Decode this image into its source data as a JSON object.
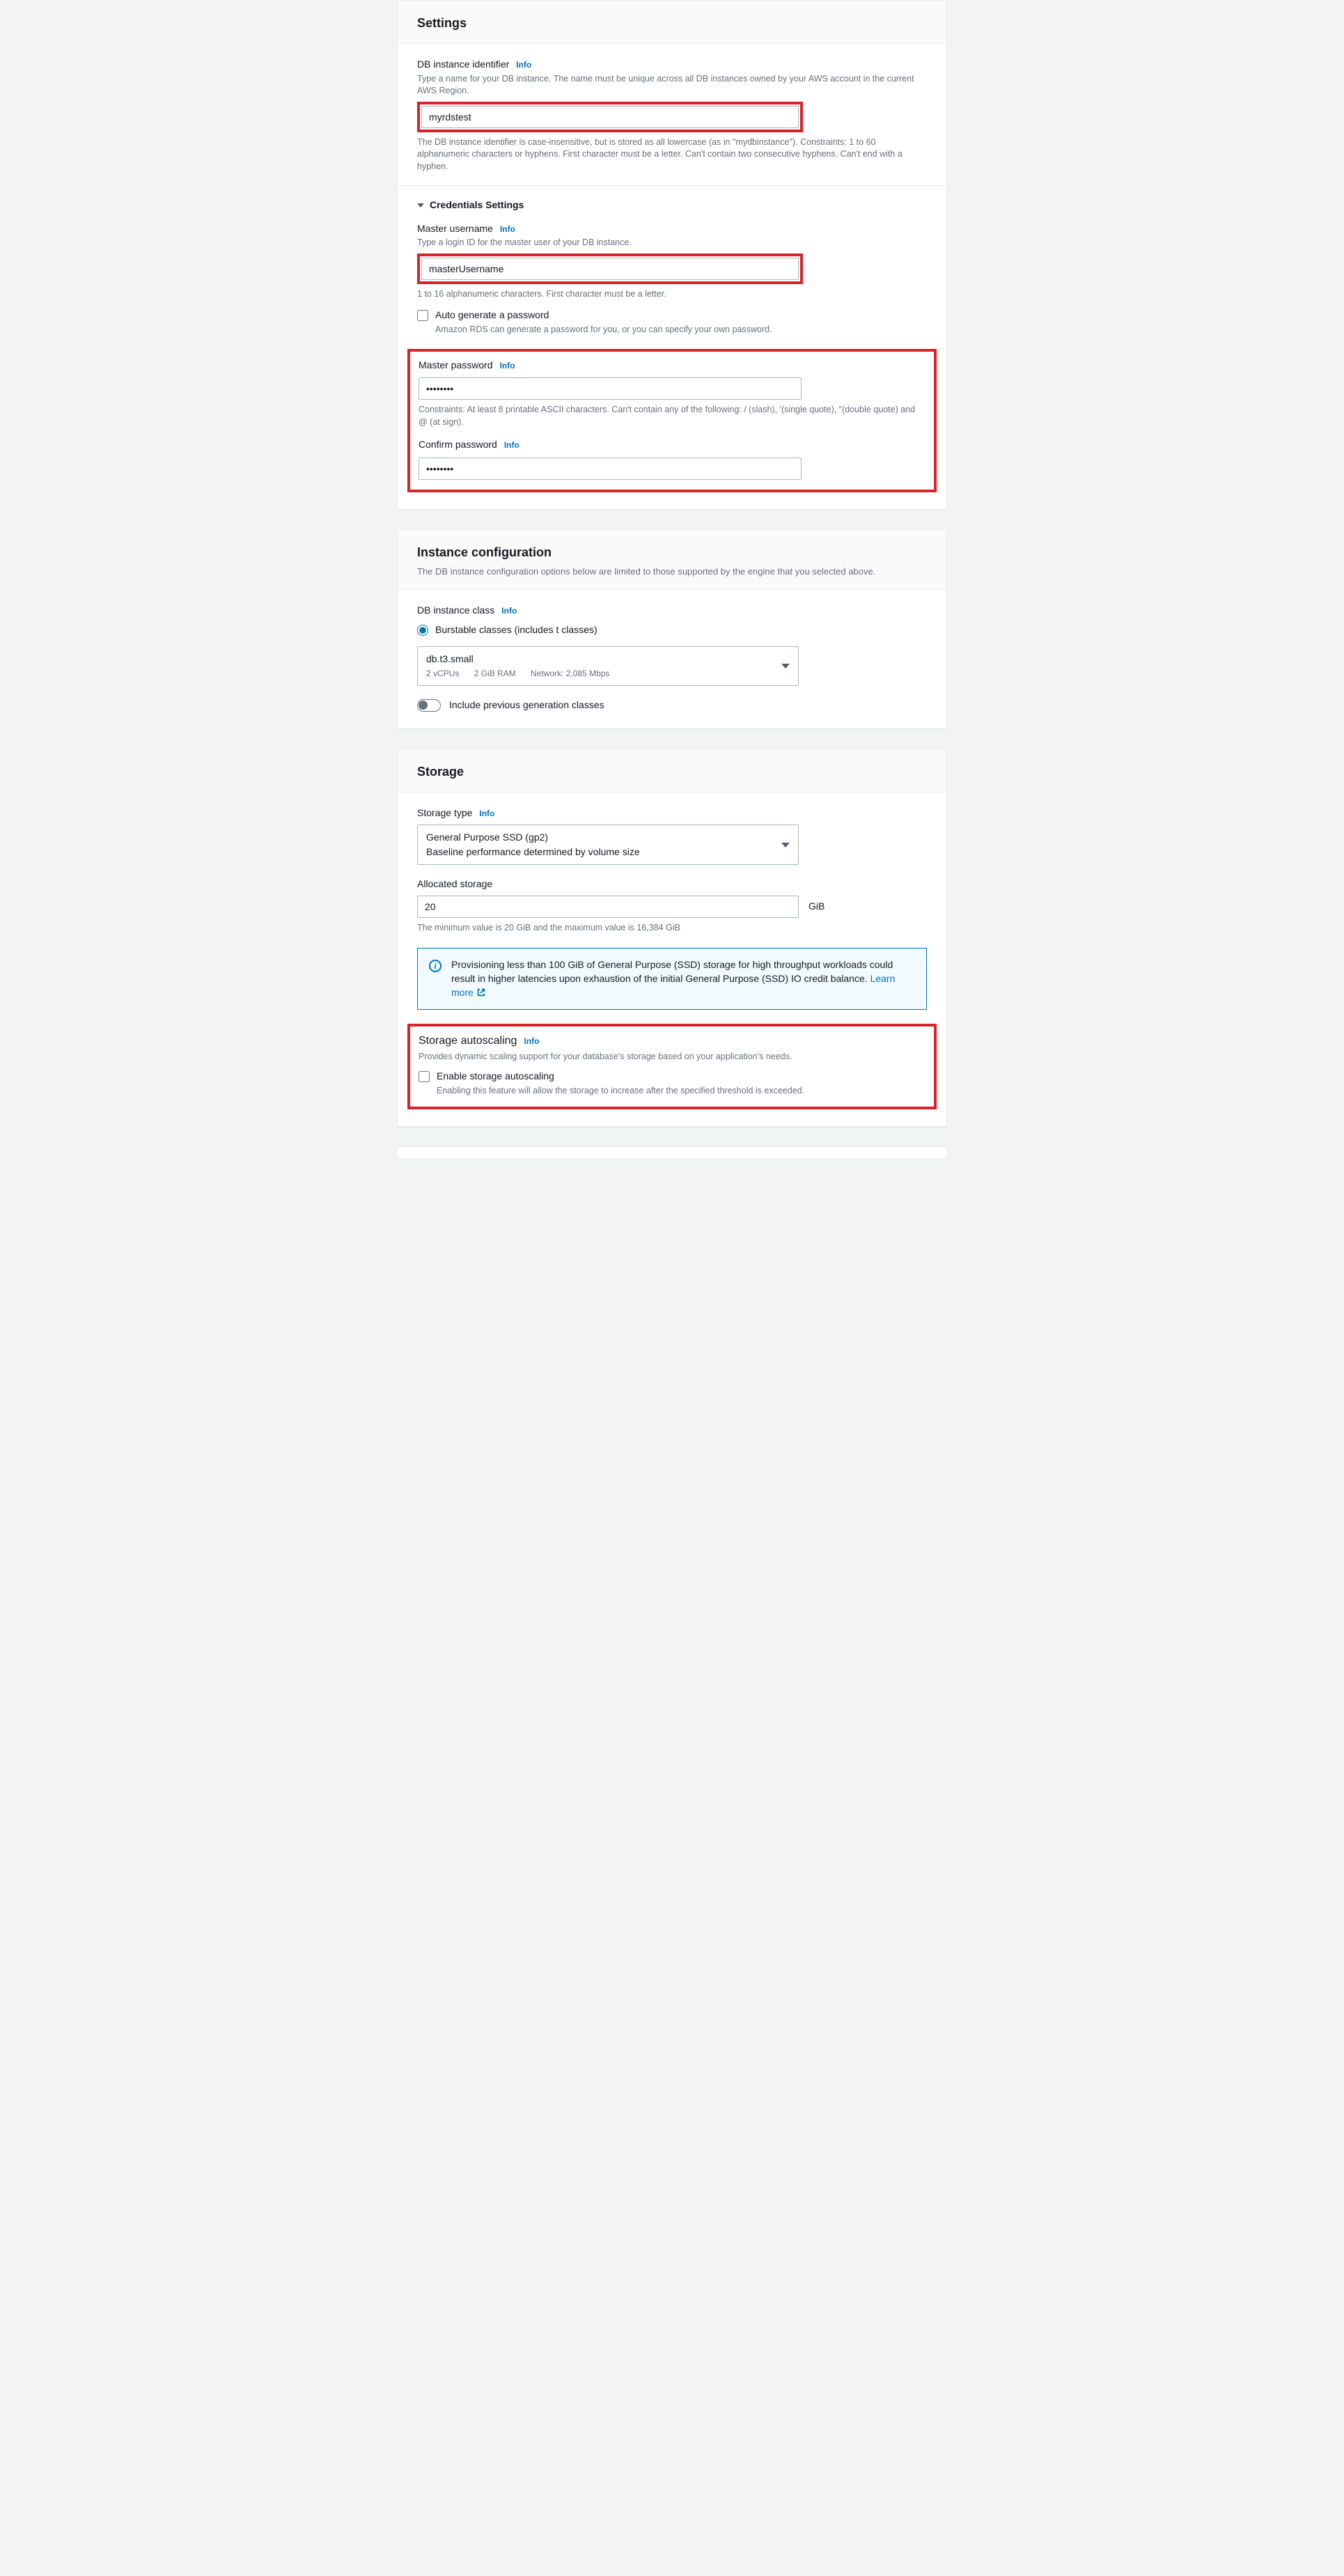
{
  "info": "Info",
  "settings": {
    "title": "Settings",
    "identifier": {
      "label": "DB instance identifier",
      "help": "Type a name for your DB instance. The name must be unique across all DB instances owned by your AWS account in the current AWS Region.",
      "value": "myrdstest",
      "constraint": "The DB instance identifier is case-insensitive, but is stored as all lowercase (as in \"mydbinstance\"). Constraints: 1 to 60 alphanumeric characters or hyphens. First character must be a letter. Can't contain two consecutive hyphens. Can't end with a hyphen."
    },
    "credentials": {
      "header": "Credentials Settings",
      "username": {
        "label": "Master username",
        "help": "Type a login ID for the master user of your DB instance.",
        "value": "masterUsername",
        "constraint": "1 to 16 alphanumeric characters. First character must be a letter."
      },
      "autogen": {
        "label": "Auto generate a password",
        "sub": "Amazon RDS can generate a password for you, or you can specify your own password."
      },
      "password": {
        "label": "Master password",
        "value": "••••••••",
        "constraint": "Constraints: At least 8 printable ASCII characters. Can't contain any of the following: / (slash), '(single quote), \"(double quote) and @ (at sign)."
      },
      "confirm": {
        "label": "Confirm password",
        "value": "••••••••"
      }
    }
  },
  "instance": {
    "title": "Instance configuration",
    "subtitle": "The DB instance configuration options below are limited to those supported by the engine that you selected above.",
    "class_label": "DB instance class",
    "burstable": "Burstable classes (includes t classes)",
    "selection": {
      "name": "db.t3.small",
      "vcpu": "2 vCPUs",
      "ram": "2 GiB RAM",
      "network": "Network: 2,085 Mbps"
    },
    "prev_gen": "Include previous generation classes"
  },
  "storage": {
    "title": "Storage",
    "type_label": "Storage type",
    "type": {
      "name": "General Purpose SSD (gp2)",
      "sub": "Baseline performance determined by volume size"
    },
    "alloc_label": "Allocated storage",
    "alloc_value": "20",
    "unit": "GiB",
    "alloc_constraint": "The minimum value is 20 GiB and the maximum value is 16,384 GiB",
    "alert": "Provisioning less than 100 GiB of General Purpose (SSD) storage for high throughput workloads could result in higher latencies upon exhaustion of the initial General Purpose (SSD) IO credit balance. ",
    "learn_more": "Learn more",
    "autoscaling": {
      "title": "Storage autoscaling",
      "sub": "Provides dynamic scaling support for your database's storage based on your application's needs.",
      "enable_label": "Enable storage autoscaling",
      "enable_sub": "Enabling this feature will allow the storage to increase after the specified threshold is exceeded."
    }
  }
}
